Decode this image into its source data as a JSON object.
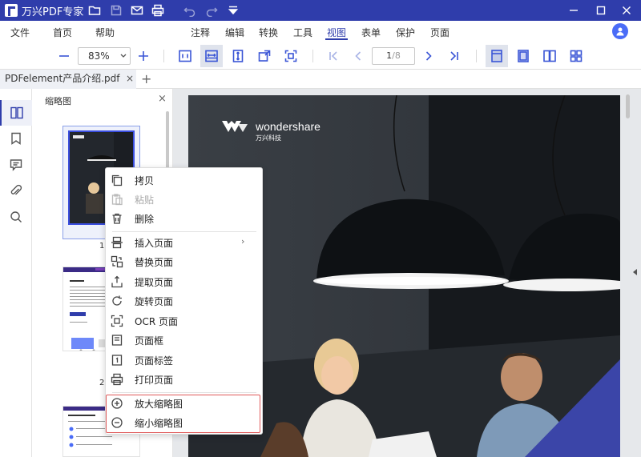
{
  "app": {
    "title": "万兴PDF专家"
  },
  "menubar": {
    "left": [
      "文件",
      "首页",
      "帮助"
    ],
    "right": [
      "注释",
      "编辑",
      "转换",
      "工具",
      "视图",
      "表单",
      "保护",
      "页面"
    ],
    "active": "视图"
  },
  "toolbar": {
    "zoom": "83%",
    "page_current": "1",
    "page_total": "/8"
  },
  "tabs": {
    "doc_name": "PDFelement产品介绍.pdf",
    "close": "×",
    "new_tab": "+"
  },
  "thumbnails": {
    "title": "缩略图",
    "close": "×",
    "page_numbers": [
      "1",
      "2"
    ],
    "page2_heading": "关于我们",
    "page3_heading": "万兴PDF产品介绍"
  },
  "document": {
    "logo_text": "wondershare",
    "logo_sub": "万兴科技"
  },
  "context_menu": {
    "items": [
      {
        "label": "拷贝",
        "icon": "copy-icon",
        "disabled": false
      },
      {
        "label": "粘贴",
        "icon": "paste-icon",
        "disabled": true
      },
      {
        "label": "删除",
        "icon": "delete-icon",
        "disabled": false
      },
      {
        "label": "插入页面",
        "icon": "insert-page-icon",
        "disabled": false,
        "submenu": "›"
      },
      {
        "label": "替换页面",
        "icon": "replace-page-icon",
        "disabled": false
      },
      {
        "label": "提取页面",
        "icon": "extract-page-icon",
        "disabled": false
      },
      {
        "label": "旋转页面",
        "icon": "rotate-icon",
        "disabled": false
      },
      {
        "label": "OCR 页面",
        "icon": "ocr-icon",
        "disabled": false
      },
      {
        "label": "页面框",
        "icon": "page-box-icon",
        "disabled": false
      },
      {
        "label": "页面标签",
        "icon": "page-label-icon",
        "disabled": false
      },
      {
        "label": "打印页面",
        "icon": "print-icon",
        "disabled": false
      },
      {
        "label": "放大缩略图",
        "icon": "zoom-in-icon",
        "disabled": false
      },
      {
        "label": "缩小缩略图",
        "icon": "zoom-out-icon",
        "disabled": false
      }
    ]
  },
  "colors": {
    "brand": "#2f3dab",
    "accent": "#3a55d6",
    "highlight": "#e05a5a"
  }
}
